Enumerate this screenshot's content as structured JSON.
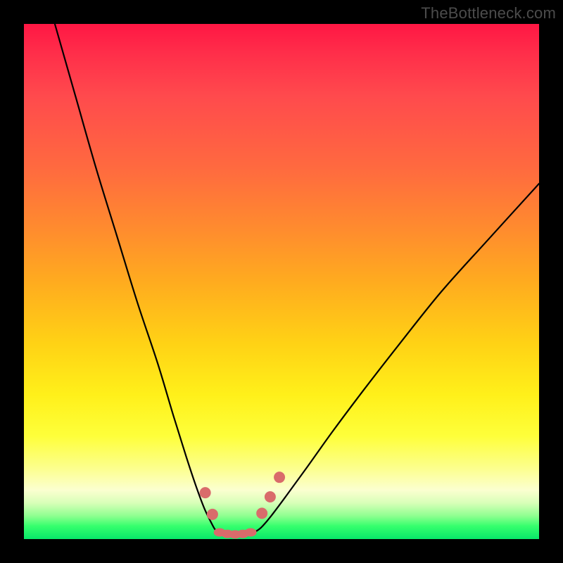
{
  "watermark": "TheBottleneck.com",
  "colors": {
    "frame": "#000000",
    "curve": "#000000",
    "dots": "#d96b6b",
    "gradient_top": "#ff1744",
    "gradient_bottom": "#08e869"
  },
  "chart_data": {
    "type": "line",
    "title": "",
    "xlabel": "",
    "ylabel": "",
    "xlim": [
      0,
      100
    ],
    "ylim": [
      0,
      100
    ],
    "grid": false,
    "legend": false,
    "series": [
      {
        "name": "left-curve",
        "x": [
          6,
          10,
          14,
          18,
          22,
          26,
          29,
          31.5,
          33.5,
          35,
          36.2,
          37,
          37.6
        ],
        "y": [
          100,
          86,
          72,
          59,
          46,
          34,
          24,
          16,
          10,
          6,
          3.5,
          2,
          1.2
        ]
      },
      {
        "name": "valley-floor",
        "x": [
          37.6,
          39,
          41,
          43,
          44.5
        ],
        "y": [
          1.2,
          0.9,
          0.8,
          0.9,
          1.2
        ]
      },
      {
        "name": "right-curve",
        "x": [
          44.5,
          46,
          48,
          51,
          55,
          60,
          66,
          73,
          81,
          90,
          100
        ],
        "y": [
          1.2,
          2.2,
          4.5,
          8.5,
          14,
          21,
          29,
          38,
          48,
          58,
          69
        ]
      }
    ],
    "markers": [
      {
        "name": "left-dot-upper",
        "x": 35.2,
        "y": 9.0
      },
      {
        "name": "left-dot-lower",
        "x": 36.6,
        "y": 4.8
      },
      {
        "name": "right-dot-lower",
        "x": 46.2,
        "y": 5.0
      },
      {
        "name": "right-dot-mid",
        "x": 47.8,
        "y": 8.2
      },
      {
        "name": "right-dot-upper",
        "x": 49.6,
        "y": 12.0
      },
      {
        "name": "floor-dot-1",
        "x": 38.0,
        "y": 1.3
      },
      {
        "name": "floor-dot-2",
        "x": 39.5,
        "y": 1.0
      },
      {
        "name": "floor-dot-3",
        "x": 41.0,
        "y": 0.9
      },
      {
        "name": "floor-dot-4",
        "x": 42.5,
        "y": 1.0
      },
      {
        "name": "floor-dot-5",
        "x": 44.0,
        "y": 1.3
      }
    ]
  }
}
